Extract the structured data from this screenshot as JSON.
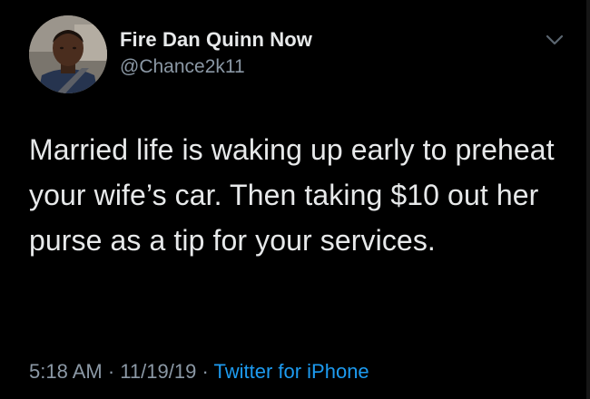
{
  "tweet": {
    "display_name": "Fire Dan Quinn Now",
    "handle": "@Chance2k11",
    "text": "Married life is waking up early to preheat your wife’s car. Then taking $10 out her purse as a tip for your services.",
    "time": "5:18 AM",
    "date": "11/19/19",
    "separator": "·",
    "source": "Twitter for iPhone",
    "avatar_icon": "profile-photo",
    "menu_icon": "chevron-down-icon"
  },
  "colors": {
    "background": "#000000",
    "text": "#e7e9ea",
    "secondary_text": "#8b98a5",
    "link": "#1d9bf0"
  }
}
